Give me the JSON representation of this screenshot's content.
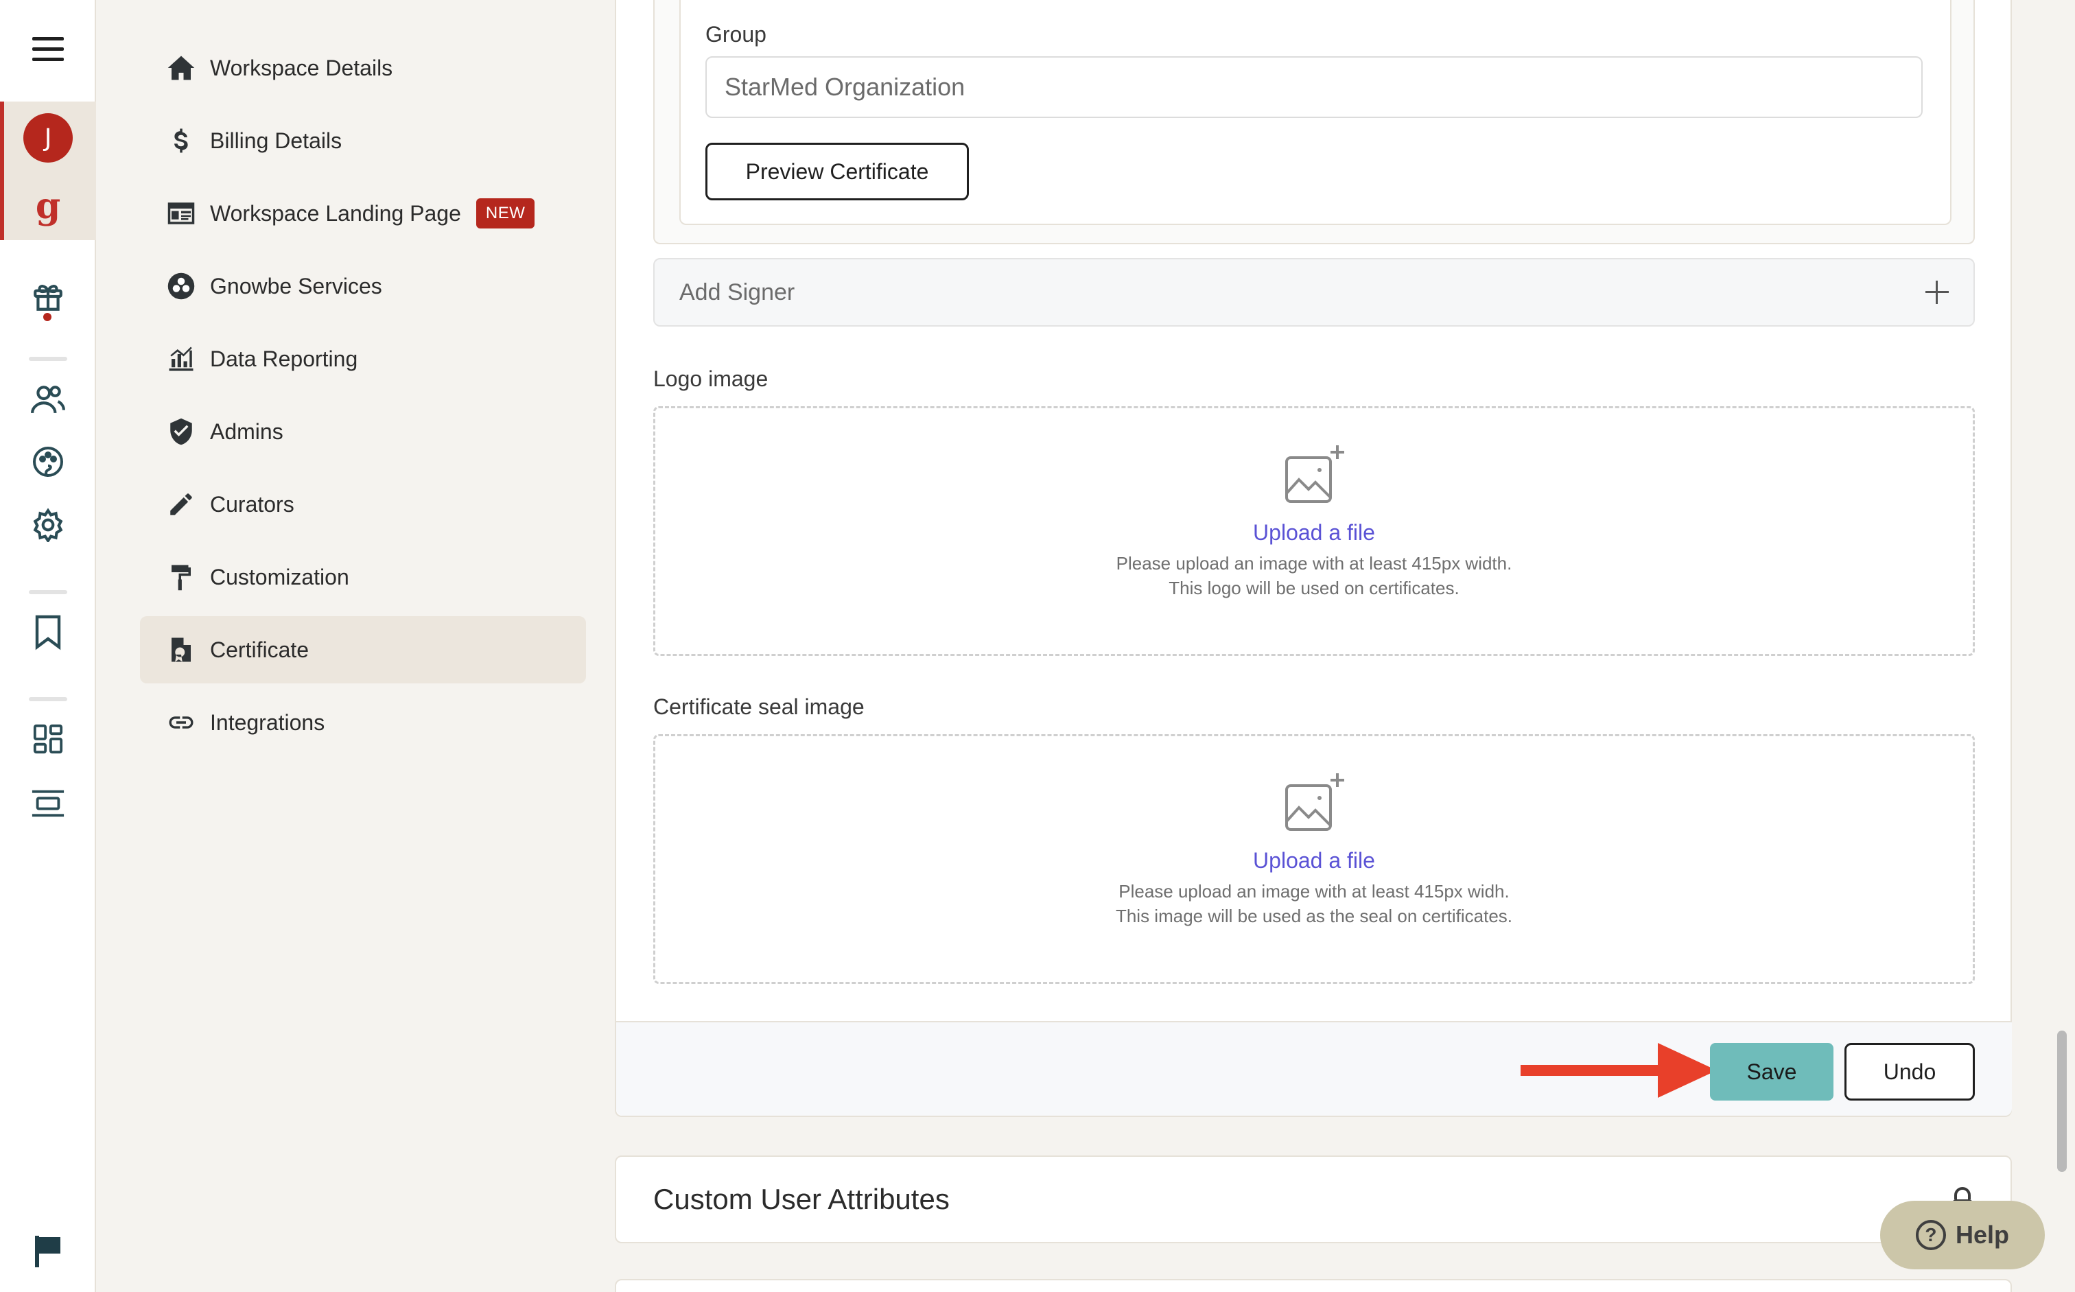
{
  "rail": {
    "avatar_initial": "J",
    "logo_glyph": "g",
    "icons": [
      "menu-icon",
      "gift-icon",
      "users-icon",
      "palette-icon",
      "settings-icon",
      "bookmark-icon",
      "dashboard-icon",
      "layout-icon",
      "flag-icon"
    ]
  },
  "settings_nav": {
    "items": [
      {
        "label": "Workspace Details",
        "icon": "home-icon"
      },
      {
        "label": "Billing Details",
        "icon": "dollar-icon"
      },
      {
        "label": "Workspace Landing Page",
        "icon": "landing-page-icon",
        "badge": "NEW"
      },
      {
        "label": "Gnowbe Services",
        "icon": "services-icon"
      },
      {
        "label": "Data Reporting",
        "icon": "chart-icon"
      },
      {
        "label": "Admins",
        "icon": "shield-icon"
      },
      {
        "label": "Curators",
        "icon": "pencil-icon"
      },
      {
        "label": "Customization",
        "icon": "paint-roller-icon"
      },
      {
        "label": "Certificate",
        "icon": "certificate-icon",
        "active": true
      },
      {
        "label": "Integrations",
        "icon": "link-icon"
      }
    ]
  },
  "certificate": {
    "group_label": "Group",
    "group_value": "StarMed Organization",
    "preview_button": "Preview Certificate",
    "add_signer": "Add Signer",
    "logo": {
      "label": "Logo image",
      "upload_link": "Upload a file",
      "hint_line1": "Please upload an image with at least 415px width.",
      "hint_line2": "This logo will be used on certificates."
    },
    "seal": {
      "label": "Certificate seal image",
      "upload_link": "Upload a file",
      "hint_line1": "Please upload an image with at least 415px widh.",
      "hint_line2": "This image will be used as the seal on certificates."
    },
    "save_button": "Save",
    "undo_button": "Undo"
  },
  "custom_attributes": {
    "title": "Custom User Attributes"
  },
  "help_button": "Help",
  "colors": {
    "accent_red": "#b5271d",
    "save_teal": "#6fbcba",
    "link_purple": "#5a52d5",
    "arrow_red": "#e8402a",
    "help_bg": "#ccc6a9"
  }
}
